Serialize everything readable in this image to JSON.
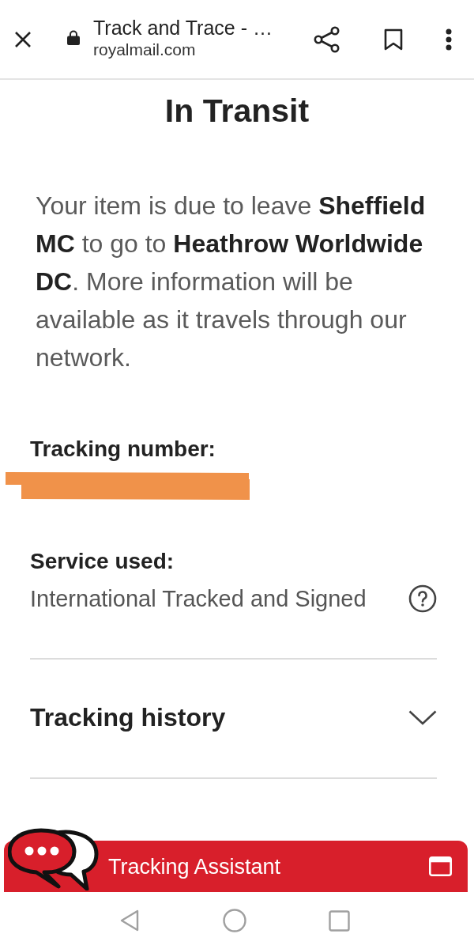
{
  "browser_bar": {
    "title": "Track and Trace - …",
    "url": "royalmail.com"
  },
  "page": {
    "heading": "In Transit",
    "status_message": "Your item is due to leave **Sheffield MC** to go to **Heathrow Worldwide DC**. More information will be available as it travels through our network.",
    "tracking_number": {
      "label": "Tracking number:",
      "redacted": true
    },
    "service": {
      "label": "Service used:",
      "value": "International Tracked and Signed"
    },
    "tracking_history": {
      "label": "Tracking history",
      "expanded": false
    }
  },
  "assistant_bar": {
    "label": "Tracking Assistant"
  }
}
